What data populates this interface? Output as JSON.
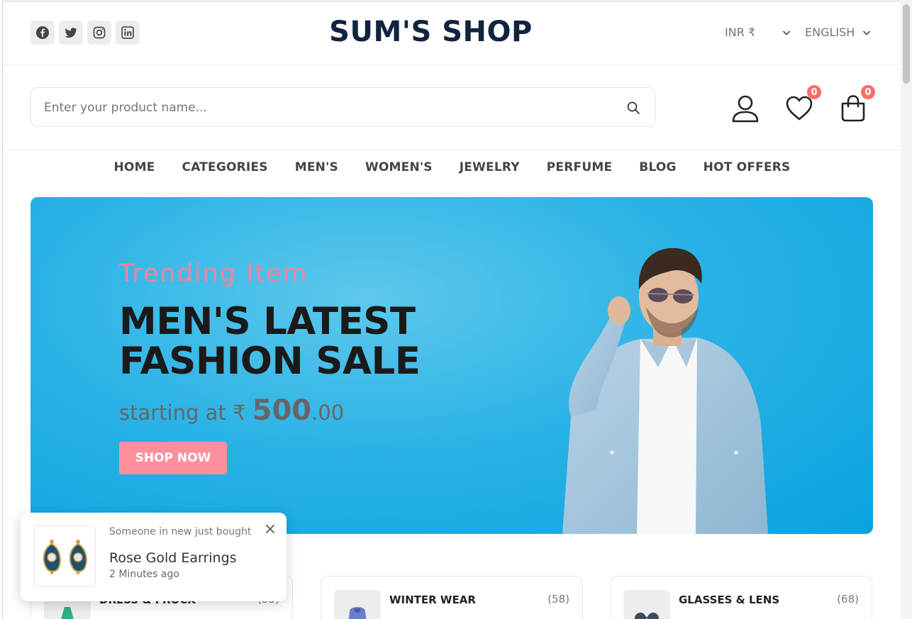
{
  "header": {
    "socials": [
      {
        "name": "facebook-icon"
      },
      {
        "name": "twitter-icon"
      },
      {
        "name": "instagram-icon"
      },
      {
        "name": "linkedin-icon"
      }
    ],
    "logo": "SUM'S SHOP",
    "currency": "INR ₹",
    "language": "ENGLISH"
  },
  "search": {
    "placeholder": "Enter your product name..."
  },
  "actions": {
    "wishlist_count": "0",
    "cart_count": "0"
  },
  "nav": {
    "items": [
      "HOME",
      "CATEGORIES",
      "MEN'S",
      "WOMEN'S",
      "JEWELRY",
      "PERFUME",
      "BLOG",
      "HOT OFFERS"
    ]
  },
  "banner": {
    "subtitle": "Trending Item",
    "title_line1": "MEN'S LATEST",
    "title_line2": "FASHION SALE",
    "price_prefix": "starting at ₹ ",
    "price_main": "500",
    "price_cents": ".00",
    "button": "SHOP NOW"
  },
  "categories": [
    {
      "name": "DRESS & FROCK",
      "count": "(53)"
    },
    {
      "name": "WINTER WEAR",
      "count": "(58)"
    },
    {
      "name": "GLASSES & LENS",
      "count": "(68)"
    }
  ],
  "toast": {
    "line1": "Someone in new just bought",
    "product": "Rose Gold Earrings",
    "time": "2 Minutes ago"
  },
  "colors": {
    "brand": "#10243e",
    "accent": "#ff8f9c",
    "badge": "#ff6b6b",
    "banner": "#2bb3e6"
  }
}
